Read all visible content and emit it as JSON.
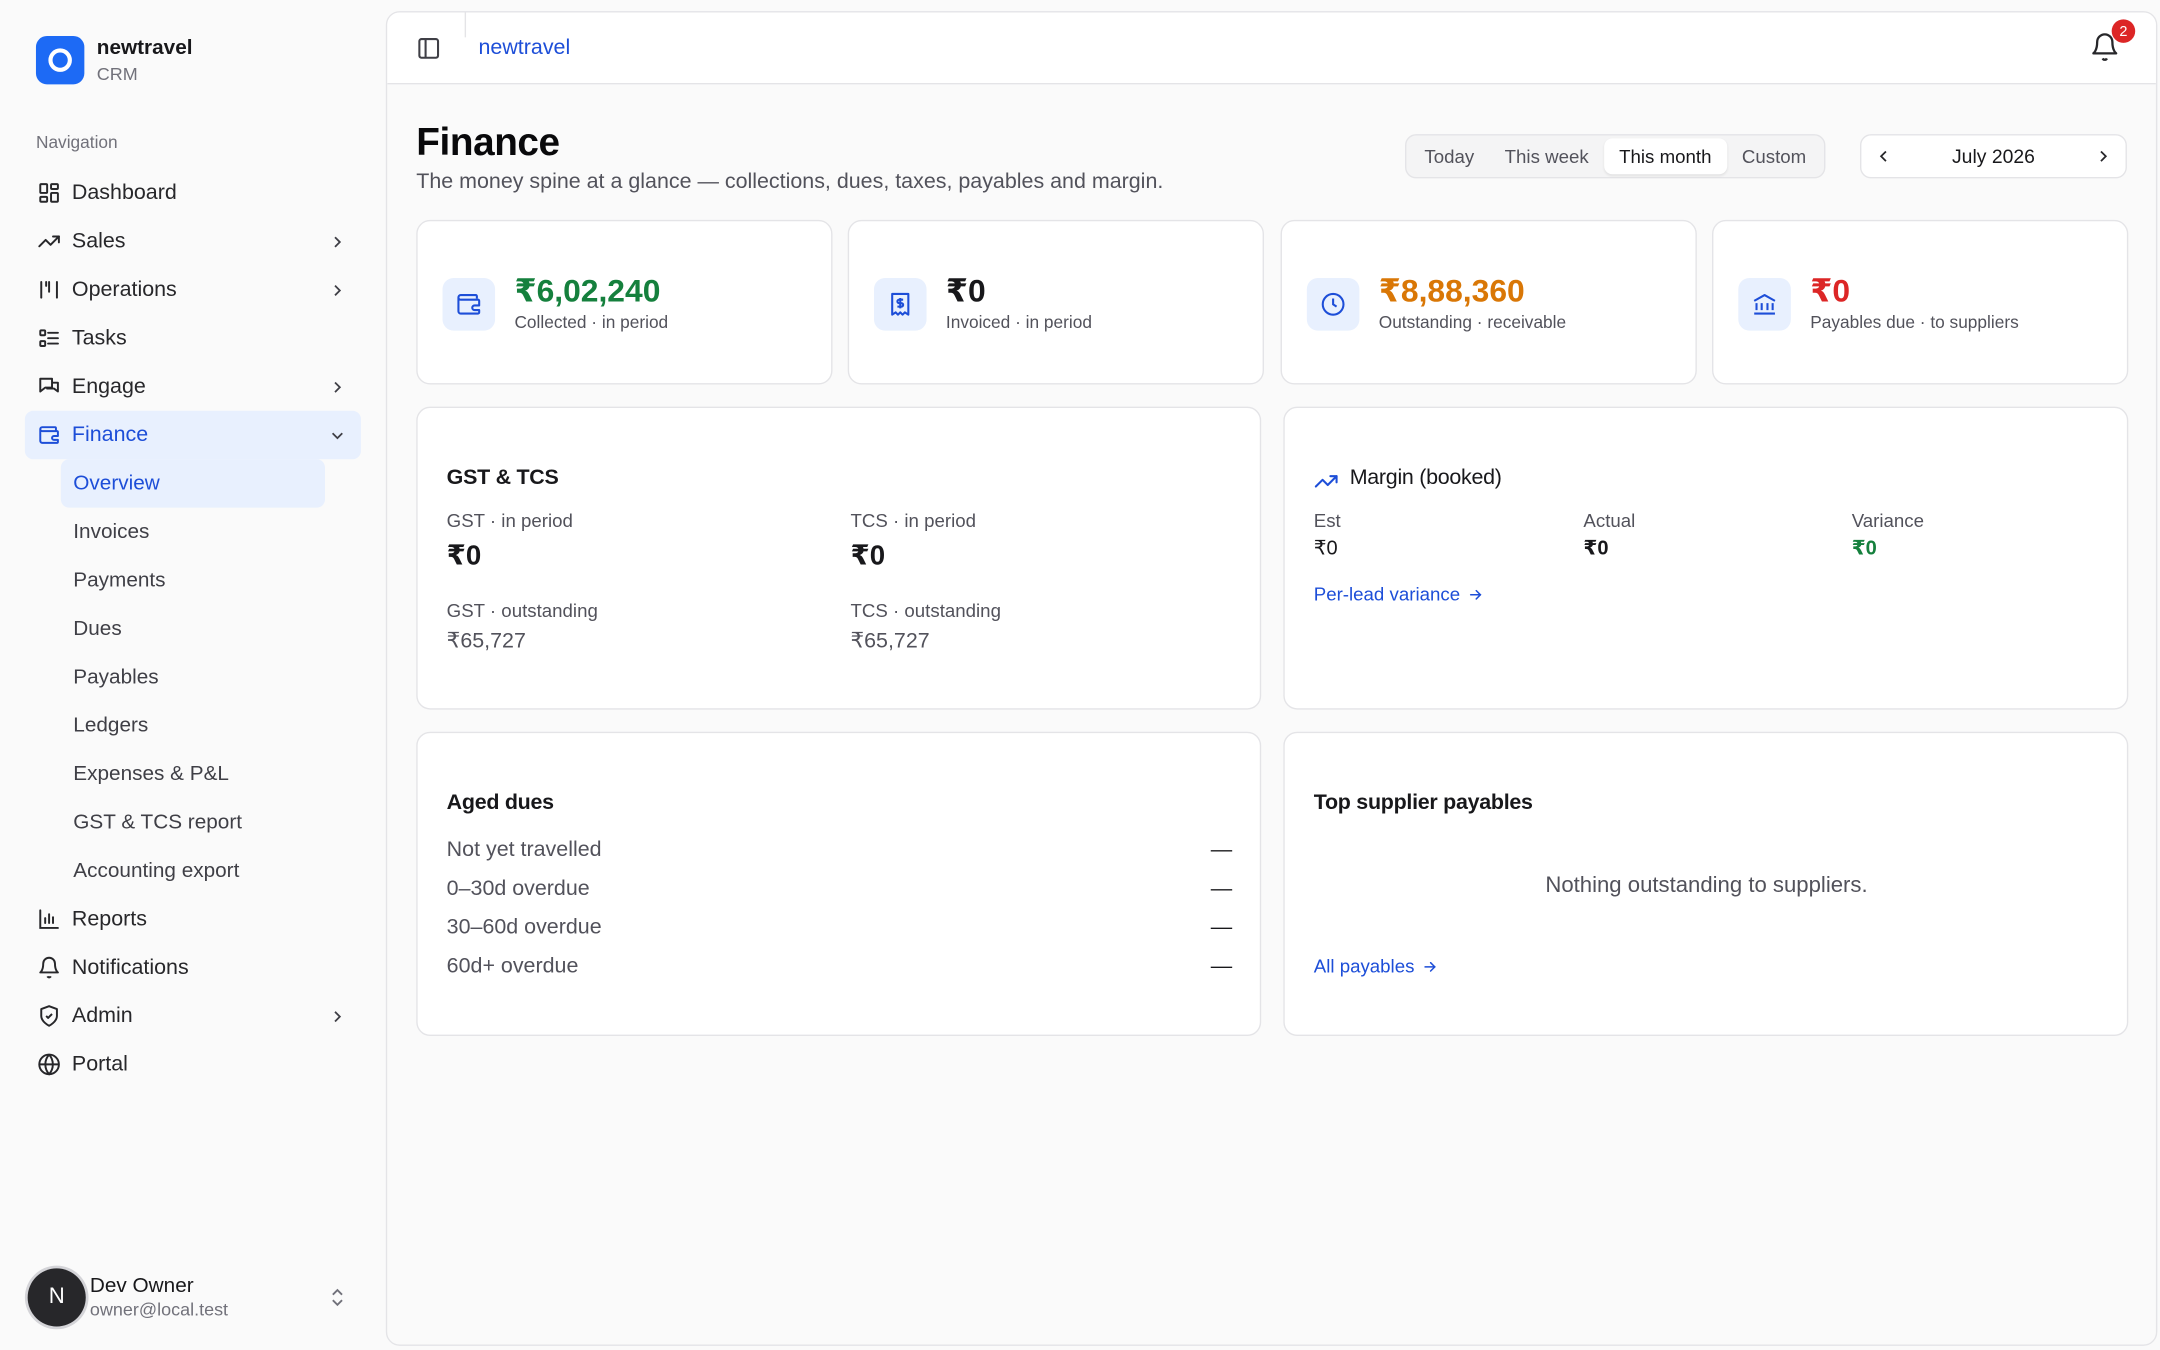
{
  "brand": {
    "name": "newtravel",
    "sub": "CRM"
  },
  "nav": {
    "heading": "Navigation",
    "items": [
      {
        "label": "Dashboard",
        "icon": "dashboard-icon"
      },
      {
        "label": "Sales",
        "icon": "trend-icon"
      },
      {
        "label": "Operations",
        "icon": "operations-icon"
      },
      {
        "label": "Tasks",
        "icon": "tasks-icon"
      },
      {
        "label": "Engage",
        "icon": "chat-icon"
      },
      {
        "label": "Finance",
        "icon": "wallet-icon"
      },
      {
        "label": "Reports",
        "icon": "bar-chart-icon"
      },
      {
        "label": "Notifications",
        "icon": "bell-icon"
      },
      {
        "label": "Admin",
        "icon": "shield-icon"
      },
      {
        "label": "Portal",
        "icon": "globe-icon"
      }
    ],
    "finance_sub": [
      "Overview",
      "Invoices",
      "Payments",
      "Dues",
      "Payables",
      "Ledgers",
      "Expenses & P&L",
      "GST & TCS report",
      "Accounting export"
    ]
  },
  "user": {
    "initial": "N",
    "name": "Dev Owner",
    "email": "owner@local.test"
  },
  "topbar": {
    "crumb": "newtravel",
    "notification_count": "2"
  },
  "page": {
    "title": "Finance",
    "subtitle": "The money spine at a glance — collections, dues, taxes, payables and margin."
  },
  "range": {
    "options": [
      "Today",
      "This week",
      "This month",
      "Custom"
    ],
    "selected": "This month",
    "period": "July 2026"
  },
  "kpis": [
    {
      "value": "₹6,02,240",
      "label": "Collected · in period",
      "icon": "wallet-icon",
      "color": "#15803d"
    },
    {
      "value": "₹0",
      "label": "Invoiced · in period",
      "icon": "receipt-icon",
      "color": "#18181b"
    },
    {
      "value": "₹8,88,360",
      "label": "Outstanding · receivable",
      "icon": "clock-icon",
      "color": "#d97706"
    },
    {
      "value": "₹0",
      "label": "Payables due · to suppliers",
      "icon": "bank-icon",
      "color": "#dc2626"
    }
  ],
  "gst": {
    "title": "GST & TCS",
    "gst_period_label": "GST · in period",
    "gst_period_value": "₹0",
    "tcs_period_label": "TCS · in period",
    "tcs_period_value": "₹0",
    "gst_out_label": "GST · outstanding",
    "gst_out_value": "₹65,727",
    "tcs_out_label": "TCS · outstanding",
    "tcs_out_value": "₹65,727"
  },
  "margin": {
    "title": "Margin (booked)",
    "est_label": "Est",
    "est_value": "₹0",
    "actual_label": "Actual",
    "actual_value": "₹0",
    "variance_label": "Variance",
    "variance_value": "₹0",
    "link": "Per-lead variance"
  },
  "aged": {
    "title": "Aged dues",
    "rows": [
      {
        "label": "Not yet travelled",
        "value": "—"
      },
      {
        "label": "0–30d overdue",
        "value": "—"
      },
      {
        "label": "30–60d overdue",
        "value": "—"
      },
      {
        "label": "60d+ overdue",
        "value": "—"
      }
    ]
  },
  "suppliers": {
    "title": "Top supplier payables",
    "empty": "Nothing outstanding to suppliers.",
    "link": "All payables"
  },
  "colors": {
    "accent": "#1d4ed8",
    "brand": "#1d6af5",
    "active_bg": "#e8f0fe",
    "badge": "#dc2626"
  }
}
